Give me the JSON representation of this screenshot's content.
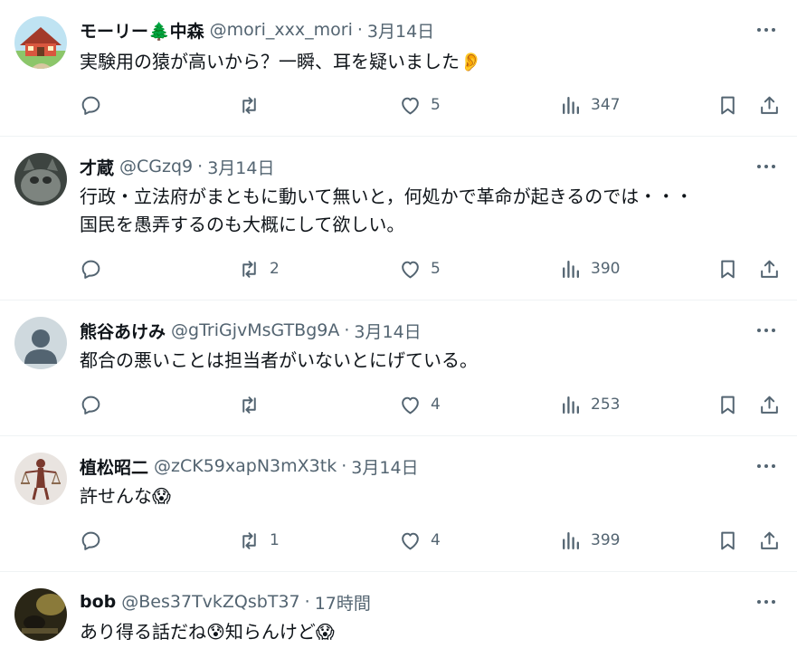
{
  "tweets": [
    {
      "name": "モーリー🌲中森",
      "handle": "@mori_xxx_mori",
      "time": "3月14日",
      "lines": [
        "実験用の猿が高いから？一瞬、耳を疑いました👂"
      ],
      "reply_count": "",
      "retweet_count": "",
      "like_count": "5",
      "view_count": "347",
      "avatar": "house-avatar"
    },
    {
      "name": "才蔵",
      "handle": "@CGzq9",
      "time": "3月14日",
      "lines": [
        "行政・立法府がまともに動いて無いと，何処かで革命が起きるのでは・・・",
        "国民を愚弄するのも大概にして欲しい。"
      ],
      "reply_count": "",
      "retweet_count": "2",
      "like_count": "5",
      "view_count": "390",
      "avatar": "cat-avatar"
    },
    {
      "name": "熊谷あけみ",
      "handle": "@gTriGjvMsGTBg9A",
      "time": "3月14日",
      "lines": [
        "都合の悪いことは担当者がいないとにげている。"
      ],
      "reply_count": "",
      "retweet_count": "",
      "like_count": "4",
      "view_count": "253",
      "avatar": "default-avatar"
    },
    {
      "name": "植松昭二",
      "handle": "@zCK59xapN3mX3tk",
      "time": "3月14日",
      "lines": [
        "許せんな😱"
      ],
      "reply_count": "",
      "retweet_count": "1",
      "like_count": "4",
      "view_count": "399",
      "avatar": "statue-avatar"
    },
    {
      "name": "bob",
      "handle": "@Bes37TvkZQsbT37",
      "time": "17時間",
      "lines": [
        "あり得る話だね😰知らんけど😱"
      ],
      "reply_count": "",
      "retweet_count": "",
      "like_count": "",
      "view_count": "",
      "avatar": "dark-photo-avatar"
    }
  ],
  "icons": {
    "reply": "reply-icon",
    "retweet": "retweet-icon",
    "like": "heart-icon",
    "views": "views-icon",
    "bookmark": "bookmark-icon",
    "share": "share-icon",
    "more": "more-icon"
  },
  "colors": {
    "text": "#0f1419",
    "secondary": "#536471",
    "divider": "#eff3f4"
  }
}
